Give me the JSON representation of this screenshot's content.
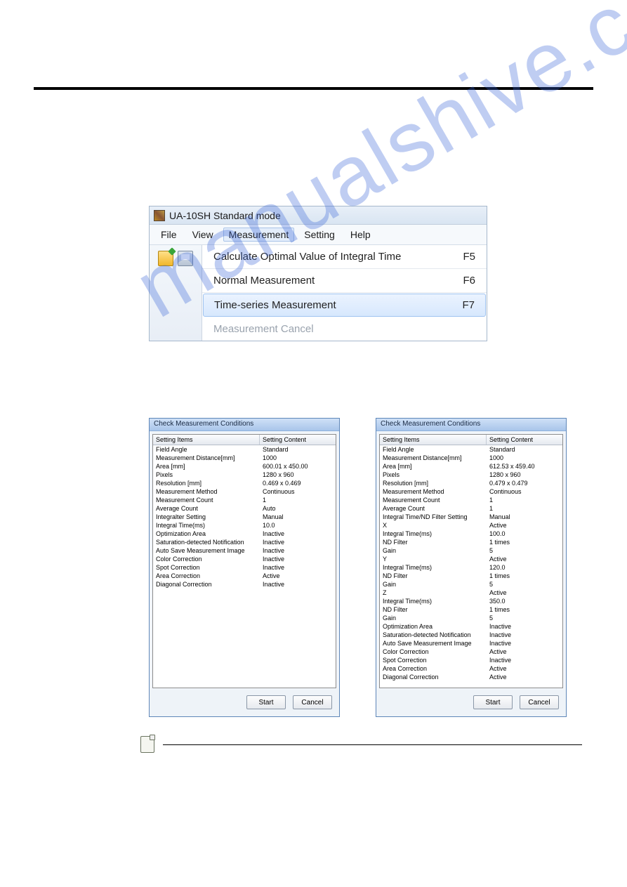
{
  "watermark": "manualshive.com",
  "app": {
    "title": "UA-10SH Standard mode",
    "menus": [
      "File",
      "View",
      "Measurement",
      "Setting",
      "Help"
    ],
    "open_menu_index": 2,
    "dropdown": [
      {
        "label": "Calculate Optimal Value of Integral Time",
        "shortcut": "F5",
        "hover": false,
        "disabled": false
      },
      {
        "label": "Normal Measurement",
        "shortcut": "F6",
        "hover": false,
        "disabled": false
      },
      {
        "label": "Time-series Measurement",
        "shortcut": "F7",
        "hover": true,
        "disabled": false
      },
      {
        "label": "Measurement Cancel",
        "shortcut": "",
        "hover": false,
        "disabled": true
      }
    ]
  },
  "dialog_left": {
    "title": "Check Measurement Conditions",
    "col1": "Setting Items",
    "col2": "Setting Content",
    "rows": [
      [
        "Field Angle",
        "Standard"
      ],
      [
        "Measurement Distance[mm]",
        "1000"
      ],
      [
        "Area [mm]",
        "600.01 x 450.00"
      ],
      [
        "Pixels",
        "1280 x 960"
      ],
      [
        "Resolution [mm]",
        "0.469 x 0.469"
      ],
      [
        "Measurement Method",
        "Continuous"
      ],
      [
        "Measurement Count",
        "1"
      ],
      [
        "Average Count",
        "Auto"
      ],
      [
        "Integralter Setting",
        "Manual"
      ],
      [
        "Integral Time(ms)",
        "10.0"
      ],
      [
        "Optimization Area",
        "Inactive"
      ],
      [
        "Saturation-detected Notification",
        "Inactive"
      ],
      [
        "Auto Save Measurement Image",
        "Inactive"
      ],
      [
        "Color Correction",
        "Inactive"
      ],
      [
        "Spot Correction",
        "Inactive"
      ],
      [
        "Area Correction",
        "Active"
      ],
      [
        "Diagonal Correction",
        "Inactive"
      ]
    ],
    "start": "Start",
    "cancel": "Cancel"
  },
  "dialog_right": {
    "title": "Check Measurement Conditions",
    "col1": "Setting Items",
    "col2": "Setting Content",
    "rows": [
      [
        "Field Angle",
        "Standard"
      ],
      [
        "Measurement Distance[mm]",
        "1000"
      ],
      [
        "Area [mm]",
        "612.53 x 459.40"
      ],
      [
        "Pixels",
        "1280 x 960"
      ],
      [
        "Resolution [mm]",
        "0.479 x 0.479"
      ],
      [
        "Measurement Method",
        "Continuous"
      ],
      [
        "Measurement Count",
        "1"
      ],
      [
        "Average Count",
        "1"
      ],
      [
        "Integral Time/ND Filter Setting",
        "Manual"
      ],
      [
        "X",
        "Active"
      ],
      [
        "Integral Time(ms)",
        "100.0"
      ],
      [
        "ND Filter",
        "1 times"
      ],
      [
        "Gain",
        "5"
      ],
      [
        "Y",
        "Active"
      ],
      [
        "Integral Time(ms)",
        "120.0"
      ],
      [
        "ND Filter",
        "1 times"
      ],
      [
        "Gain",
        "5"
      ],
      [
        "Z",
        "Active"
      ],
      [
        "Integral Time(ms)",
        "350.0"
      ],
      [
        "ND Filter",
        "1 times"
      ],
      [
        "Gain",
        "5"
      ],
      [
        "Optimization Area",
        "Inactive"
      ],
      [
        "Saturation-detected Notification",
        "Inactive"
      ],
      [
        "Auto Save Measurement Image",
        "Inactive"
      ],
      [
        "Color Correction",
        "Active"
      ],
      [
        "Spot Correction",
        "Inactive"
      ],
      [
        "Area Correction",
        "Active"
      ],
      [
        "Diagonal Correction",
        "Active"
      ]
    ],
    "start": "Start",
    "cancel": "Cancel"
  }
}
